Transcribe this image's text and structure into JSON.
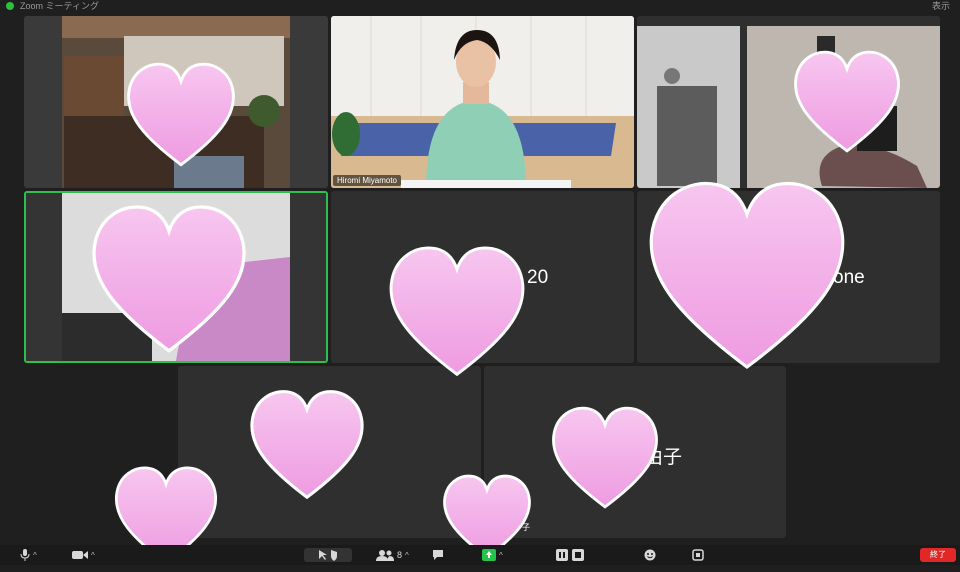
{
  "window": {
    "title": "Zoom ミーティング",
    "right_label": "表示"
  },
  "tiles": {
    "t2_name": "Hiromi Miyamoto",
    "t5_label": "20",
    "t6_label": "one",
    "t8_label": "由子",
    "t8_small": "子"
  },
  "toolbar": {
    "participants_count": "8",
    "end_label": "終了"
  },
  "icons": [
    "mic-icon",
    "video-icon",
    "security-icon",
    "participants-icon",
    "chat-icon",
    "share-icon",
    "record-icon",
    "reactions-icon",
    "apps-icon"
  ],
  "colors": {
    "active_border": "#2fbf4e",
    "heart": "#f3b6ea",
    "end": "#e02828"
  }
}
